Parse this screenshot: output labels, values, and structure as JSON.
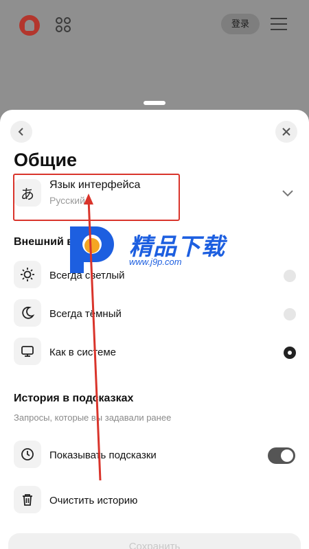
{
  "header": {
    "login_label": "登录",
    "icons": [
      "alice-logo",
      "apps-grid-icon",
      "menu-icon"
    ]
  },
  "sheet": {
    "title": "Общие",
    "language": {
      "title": "Язык интерфейса",
      "value": "Русский",
      "icon": "language-icon",
      "glyph": "あ"
    },
    "appearance": {
      "section_title": "Внешний вид",
      "options": [
        {
          "label": "Всегда светлый",
          "icon": "sun-icon",
          "selected": false
        },
        {
          "label": "Всегда тёмный",
          "icon": "moon-icon",
          "selected": false
        },
        {
          "label": "Как в системе",
          "icon": "monitor-icon",
          "selected": true
        }
      ]
    },
    "history": {
      "section_title": "История в подсказках",
      "subtitle": "Запросы, которые вы задавали ранее",
      "show_suggestions_label": "Показывать подсказки",
      "show_suggestions_enabled": true,
      "clear_label": "Очистить историю"
    },
    "save_label": "Сохранить"
  },
  "watermark": {
    "text": "精品下载",
    "url": "www.j9p.com"
  },
  "colors": {
    "highlight": "#d9342b",
    "watermark": "#1d5fe0",
    "overlay": "#8f8f8f"
  }
}
